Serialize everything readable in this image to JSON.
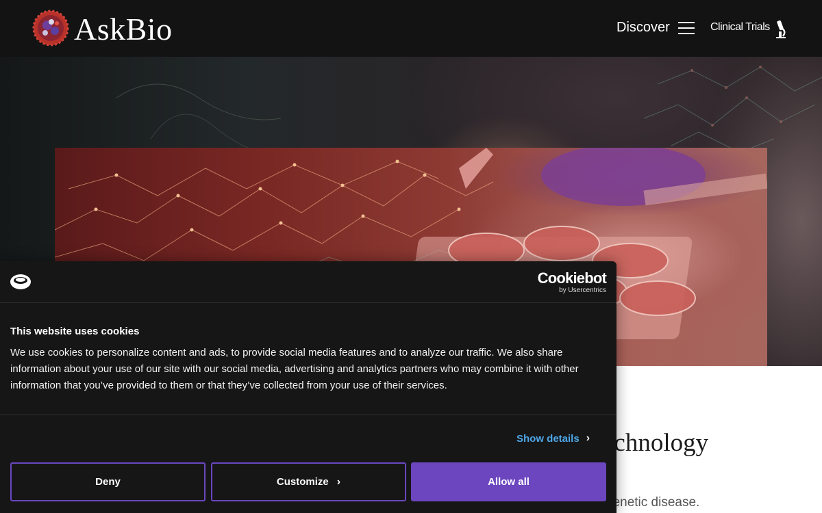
{
  "header": {
    "brand": "AskBio",
    "discover_label": "Discover",
    "clinical_trials_label": "Clinical Trials"
  },
  "main": {
    "heading_partial": "echnology",
    "subtext_partial": "genetic disease."
  },
  "cookie_dialog": {
    "provider_name": "Cookiebot",
    "provider_by": "by Usercentrics",
    "title": "This website uses cookies",
    "text": "We use cookies to personalize content and ads, to provide social media features and to analyze our traffic. We also share information about your use of our site with our social media, advertising and analytics partners who may combine it with other information that you’ve provided to them or that they’ve collected from your use of their services.",
    "show_details_label": "Show details",
    "buttons": {
      "deny": "Deny",
      "customize": "Customize",
      "allow_all": "Allow all"
    }
  },
  "colors": {
    "header_bg": "#131313",
    "dialog_bg": "#161616",
    "accent_purple": "#6c46bf",
    "link_blue": "#4ea6e6"
  },
  "icons": [
    "virus-logo-icon",
    "hamburger-menu-icon",
    "microscope-icon",
    "cookie-icon",
    "chevron-right-icon"
  ]
}
